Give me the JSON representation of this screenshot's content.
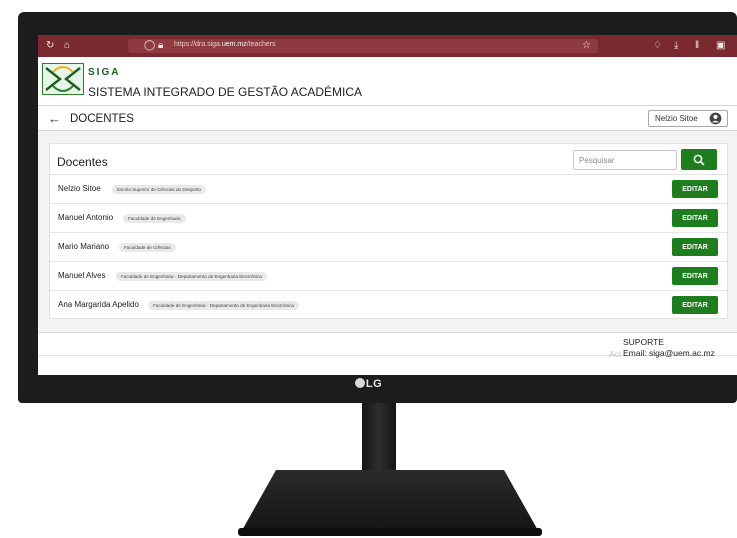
{
  "browser": {
    "url_prefix": "https://dra.siga.",
    "url_domain": "uem.mz",
    "url_path": "/teachers"
  },
  "app": {
    "logo_word": "SIGA",
    "full_name": "SISTEMA INTEGRADO DE GESTÃO ACADÉMICA"
  },
  "page": {
    "title": "DOCENTES",
    "user_name": "Nelzio Sitoe"
  },
  "card": {
    "title": "Docentes",
    "search_placeholder": "Pesquisar",
    "rows": [
      {
        "name": "Nelzio Sitoe",
        "faculty": "Escola Superior de Ciências do Desporto",
        "action": "EDITAR"
      },
      {
        "name": "Manuel Antonio",
        "faculty": "Faculdade de Engenharia",
        "action": "EDITAR"
      },
      {
        "name": "Mario Mariano",
        "faculty": "Faculdade de Ciências",
        "action": "EDITAR"
      },
      {
        "name": "Manuel Alves",
        "faculty": "Faculdade de Engenharia - Departamento de Engenharia Electrónica",
        "action": "EDITAR"
      },
      {
        "name": "Ana Margarida Apelido",
        "faculty": "Faculdade de Engenharia - Departamento de Engenharia Electrónica",
        "action": "EDITAR"
      }
    ]
  },
  "footer": {
    "support_title": "SUPORTE",
    "email_label": "Email:",
    "email": "siga@uem.ac.mz",
    "watermark": "Act"
  },
  "monitor": {
    "brand": "LG"
  },
  "colors": {
    "browser_bar": "#7a2a2f",
    "primary_green": "#1e7d1e",
    "bezel": "#1c1c1c"
  }
}
